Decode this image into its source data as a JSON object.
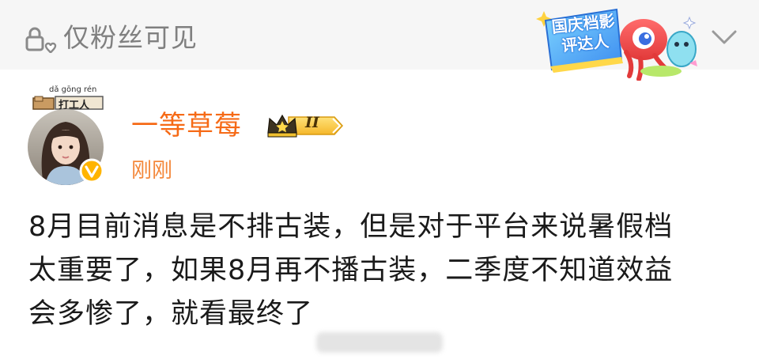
{
  "header": {
    "visibility_label": "仅粉丝可见",
    "badge_title": "国庆档影评达人",
    "expand_icon": "chevron-down-icon"
  },
  "author": {
    "avatar_pinyin": "dǎ gōng rén",
    "avatar_tag": "打工人",
    "name": "一等草莓",
    "member_level": "II",
    "time": "刚刚",
    "verified_icon": "v-verified-icon"
  },
  "post": {
    "lines": [
      "8月目前消息是不排古装，但是对于平台来说暑假档",
      "太重要了，如果8月再不播古装，二季度不知道效益",
      "会多惨了，就看最终了"
    ]
  },
  "colors": {
    "username": "#f66a16",
    "timestamp": "#f4883b",
    "topbar_bg": "#f6f6f6",
    "muted": "#808080",
    "body_text": "#1a1a1a"
  }
}
